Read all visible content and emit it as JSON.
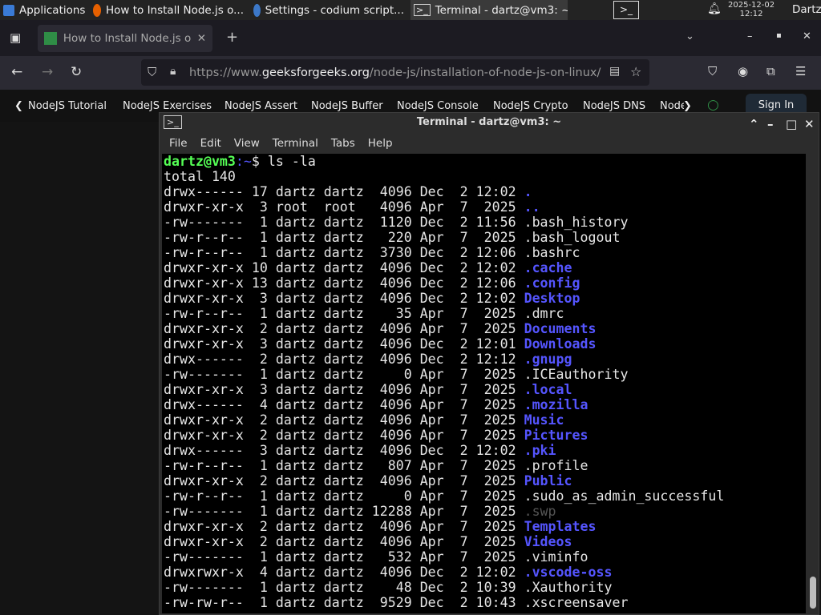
{
  "panel": {
    "applications": "Applications",
    "tasks": [
      "How to Install Node.js o...",
      "Settings - codium script...",
      "Terminal - dartz@vm3: ~"
    ],
    "date": "2025-12-02",
    "time": "12:12",
    "user": "Dartz"
  },
  "browser": {
    "tab_title": "How to Install Node.js or",
    "url_prefix": "https://www.",
    "url_domain": "geeksforgeeks.org",
    "url_path": "/node-js/installation-of-node-js-on-linux/",
    "bookmarks": [
      "NodeJS Tutorial",
      "NodeJS Exercises",
      "NodeJS Assert",
      "NodeJS Buffer",
      "NodeJS Console",
      "NodeJS Crypto",
      "NodeJS DNS",
      "Node"
    ],
    "sign_in": "Sign In"
  },
  "terminal": {
    "title": "Terminal - dartz@vm3: ~",
    "menu": [
      "File",
      "Edit",
      "View",
      "Terminal",
      "Tabs",
      "Help"
    ],
    "prompt_user": "dartz@vm3",
    "prompt_path": ":~",
    "prompt_symbol": "$ ",
    "command": "ls -la",
    "total": "total 140",
    "rows": [
      [
        "drwx------",
        "17",
        "dartz",
        "dartz",
        "4096",
        "Dec",
        "2",
        "12:02",
        ".",
        "dir"
      ],
      [
        "drwxr-xr-x",
        "3",
        "root",
        "root",
        "4096",
        "Apr",
        "7",
        "2025",
        "..",
        "dir"
      ],
      [
        "-rw-------",
        "1",
        "dartz",
        "dartz",
        "1120",
        "Dec",
        "2",
        "11:56",
        ".bash_history",
        "file"
      ],
      [
        "-rw-r--r--",
        "1",
        "dartz",
        "dartz",
        "220",
        "Apr",
        "7",
        "2025",
        ".bash_logout",
        "file"
      ],
      [
        "-rw-r--r--",
        "1",
        "dartz",
        "dartz",
        "3730",
        "Dec",
        "2",
        "12:06",
        ".bashrc",
        "file"
      ],
      [
        "drwxr-xr-x",
        "10",
        "dartz",
        "dartz",
        "4096",
        "Dec",
        "2",
        "12:02",
        ".cache",
        "dir"
      ],
      [
        "drwxr-xr-x",
        "13",
        "dartz",
        "dartz",
        "4096",
        "Dec",
        "2",
        "12:06",
        ".config",
        "dir"
      ],
      [
        "drwxr-xr-x",
        "3",
        "dartz",
        "dartz",
        "4096",
        "Dec",
        "2",
        "12:02",
        "Desktop",
        "dir"
      ],
      [
        "-rw-r--r--",
        "1",
        "dartz",
        "dartz",
        "35",
        "Apr",
        "7",
        "2025",
        ".dmrc",
        "file"
      ],
      [
        "drwxr-xr-x",
        "2",
        "dartz",
        "dartz",
        "4096",
        "Apr",
        "7",
        "2025",
        "Documents",
        "dir"
      ],
      [
        "drwxr-xr-x",
        "3",
        "dartz",
        "dartz",
        "4096",
        "Dec",
        "2",
        "12:01",
        "Downloads",
        "dir"
      ],
      [
        "drwx------",
        "2",
        "dartz",
        "dartz",
        "4096",
        "Dec",
        "2",
        "12:12",
        ".gnupg",
        "dir"
      ],
      [
        "-rw-------",
        "1",
        "dartz",
        "dartz",
        "0",
        "Apr",
        "7",
        "2025",
        ".ICEauthority",
        "file"
      ],
      [
        "drwxr-xr-x",
        "3",
        "dartz",
        "dartz",
        "4096",
        "Apr",
        "7",
        "2025",
        ".local",
        "dir"
      ],
      [
        "drwx------",
        "4",
        "dartz",
        "dartz",
        "4096",
        "Apr",
        "7",
        "2025",
        ".mozilla",
        "dir"
      ],
      [
        "drwxr-xr-x",
        "2",
        "dartz",
        "dartz",
        "4096",
        "Apr",
        "7",
        "2025",
        "Music",
        "dir"
      ],
      [
        "drwxr-xr-x",
        "2",
        "dartz",
        "dartz",
        "4096",
        "Apr",
        "7",
        "2025",
        "Pictures",
        "dir"
      ],
      [
        "drwx------",
        "3",
        "dartz",
        "dartz",
        "4096",
        "Dec",
        "2",
        "12:02",
        ".pki",
        "dir"
      ],
      [
        "-rw-r--r--",
        "1",
        "dartz",
        "dartz",
        "807",
        "Apr",
        "7",
        "2025",
        ".profile",
        "file"
      ],
      [
        "drwxr-xr-x",
        "2",
        "dartz",
        "dartz",
        "4096",
        "Apr",
        "7",
        "2025",
        "Public",
        "dir"
      ],
      [
        "-rw-r--r--",
        "1",
        "dartz",
        "dartz",
        "0",
        "Apr",
        "7",
        "2025",
        ".sudo_as_admin_successful",
        "file"
      ],
      [
        "-rw-------",
        "1",
        "dartz",
        "dartz",
        "12288",
        "Apr",
        "7",
        "2025",
        ".swp",
        "swap"
      ],
      [
        "drwxr-xr-x",
        "2",
        "dartz",
        "dartz",
        "4096",
        "Apr",
        "7",
        "2025",
        "Templates",
        "dir"
      ],
      [
        "drwxr-xr-x",
        "2",
        "dartz",
        "dartz",
        "4096",
        "Apr",
        "7",
        "2025",
        "Videos",
        "dir"
      ],
      [
        "-rw-------",
        "1",
        "dartz",
        "dartz",
        "532",
        "Apr",
        "7",
        "2025",
        ".viminfo",
        "file"
      ],
      [
        "drwxrwxr-x",
        "4",
        "dartz",
        "dartz",
        "4096",
        "Dec",
        "2",
        "12:02",
        ".vscode-oss",
        "dir"
      ],
      [
        "-rw-------",
        "1",
        "dartz",
        "dartz",
        "48",
        "Dec",
        "2",
        "10:39",
        ".Xauthority",
        "file"
      ],
      [
        "-rw-rw-r--",
        "1",
        "dartz",
        "dartz",
        "9529",
        "Dec",
        "2",
        "10:43",
        ".xscreensaver",
        "file"
      ]
    ]
  },
  "colors": {
    "prompt": "#55ff55",
    "directory": "#5555ff",
    "path": "#5555ff"
  }
}
